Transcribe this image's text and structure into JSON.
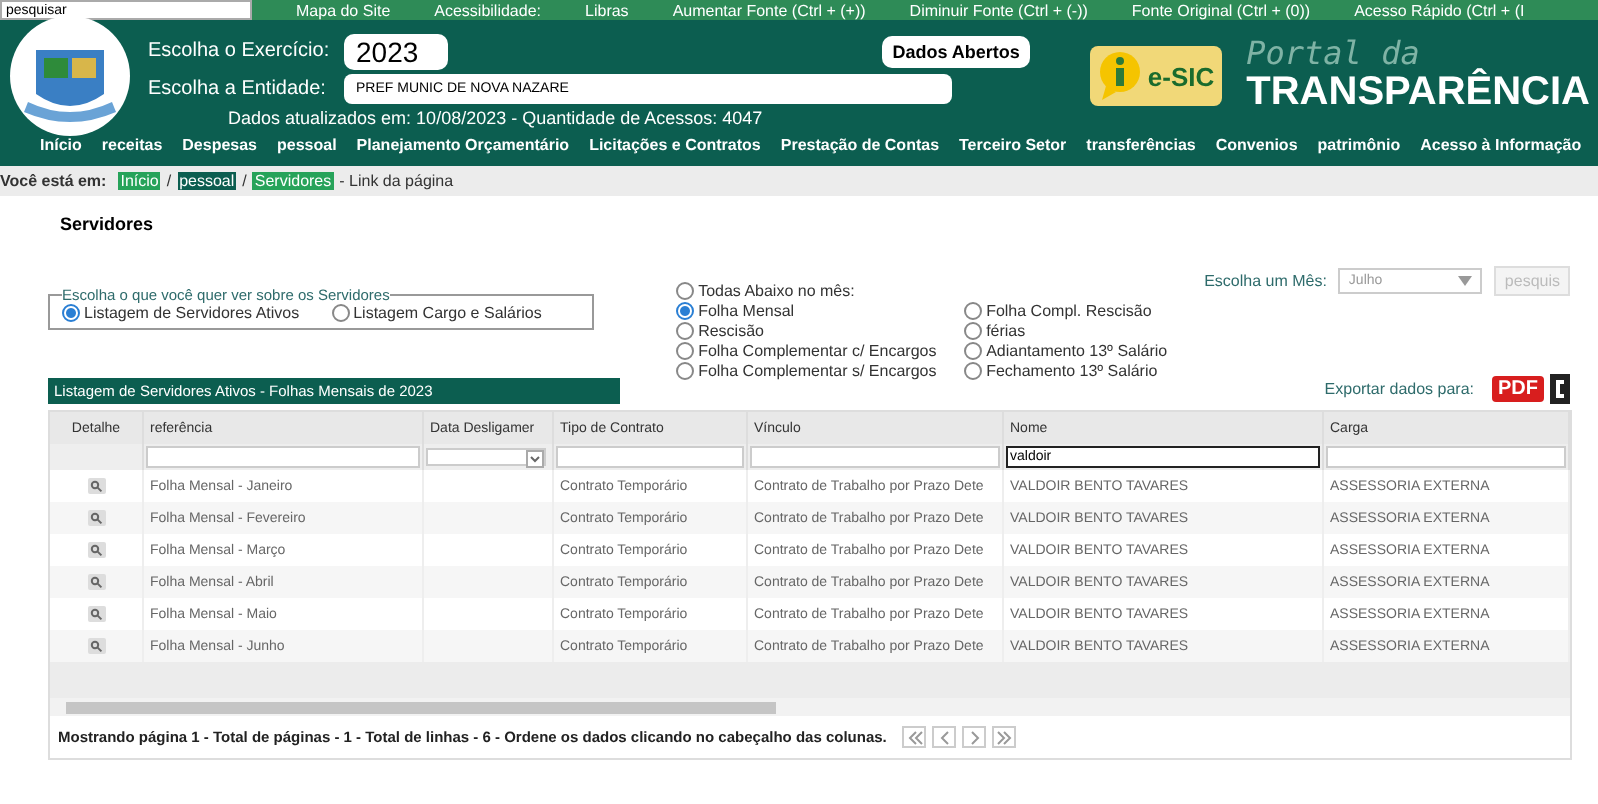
{
  "top_bar": {
    "search": {
      "value": "pesquisar"
    },
    "links": [
      "Mapa do Site",
      "Acessibilidade:",
      "Libras",
      "Aumentar Fonte (Ctrl + (+))",
      "Diminuir Fonte (Ctrl + (-))",
      "Fonte Original (Ctrl + (0))",
      "Acesso Rápido (Ctrl + (I"
    ]
  },
  "header": {
    "exercise_label": "Escolha o Exercício:",
    "exercise_value": "2023",
    "entity_label": "Escolha a Entidade:",
    "entity_value": "PREF MUNIC DE NOVA NAZARE",
    "open_data_button": "Dados Abertos",
    "updated_text": "Dados atualizados em: 10/08/2023 - Quantidade de Acessos: 4047",
    "esic_logo": "e-SIC",
    "portal_line1": "Portal da",
    "portal_line2": "TRANSPARÊNCIA"
  },
  "nav": [
    "Início",
    "receitas",
    "Despesas",
    "pessoal",
    "Planejamento Orçamentário",
    "Licitações e Contratos",
    "Prestação de Contas",
    "Terceiro Setor",
    "transferências",
    "Convenios",
    "patrimônio",
    "Acesso à Informação"
  ],
  "breadcrumb": {
    "label": "Você está em:",
    "items": [
      "Início",
      "pessoal",
      "Servidores"
    ],
    "separators": [
      "/",
      "/"
    ],
    "suffix": "- Link da página"
  },
  "page_title": "Servidores",
  "view_choice": {
    "legend": "Escolha o que você quer ver sobre os Servidores",
    "options": [
      {
        "label": "Listagem de Servidores Ativos",
        "selected": true
      },
      {
        "label": "Listagem Cargo e Salários",
        "selected": false
      }
    ]
  },
  "payroll_types": [
    {
      "label": "Todas Abaixo no mês:",
      "selected": false
    },
    {
      "label": "Folha Mensal",
      "selected": true
    },
    {
      "label": "Folha Compl. Rescisão",
      "selected": false
    },
    {
      "label": "Rescisão",
      "selected": false
    },
    {
      "label": "férias",
      "selected": false
    },
    {
      "label": "Folha Complementar c/ Encargos",
      "selected": false
    },
    {
      "label": "Adiantamento 13º Salário",
      "selected": false
    },
    {
      "label": "Folha Complementar s/ Encargos",
      "selected": false
    },
    {
      "label": "Fechamento 13º Salário",
      "selected": false
    }
  ],
  "month_filter": {
    "label": "Escolha um Mês:",
    "value": "Julho",
    "button": "pesquis",
    "disabled": true
  },
  "export": {
    "label": "Exportar dados para:",
    "pdf_button": "PDF"
  },
  "table": {
    "title": "Listagem de Servidores Ativos - Folhas Mensais de 2023",
    "columns": [
      "Detalhe",
      "referência",
      "Data Desligamer",
      "Tipo de Contrato",
      "Vínculo",
      "Nome",
      "Carga"
    ],
    "filters": [
      {
        "kind": "none"
      },
      {
        "kind": "text"
      },
      {
        "kind": "select"
      },
      {
        "kind": "text"
      },
      {
        "kind": "text"
      },
      {
        "kind": "text",
        "value": "valdoir",
        "focused": true
      },
      {
        "kind": "text"
      }
    ],
    "rows": [
      [
        "",
        "Folha Mensal - Janeiro",
        "",
        "Contrato Temporário",
        "Contrato de Trabalho por Prazo Dete",
        "VALDOIR BENTO TAVARES",
        "ASSESSORIA EXTERNA"
      ],
      [
        "",
        "Folha Mensal - Fevereiro",
        "",
        "Contrato Temporário",
        "Contrato de Trabalho por Prazo Dete",
        "VALDOIR BENTO TAVARES",
        "ASSESSORIA EXTERNA"
      ],
      [
        "",
        "Folha Mensal - Março",
        "",
        "Contrato Temporário",
        "Contrato de Trabalho por Prazo Dete",
        "VALDOIR BENTO TAVARES",
        "ASSESSORIA EXTERNA"
      ],
      [
        "",
        "Folha Mensal - Abril",
        "",
        "Contrato Temporário",
        "Contrato de Trabalho por Prazo Dete",
        "VALDOIR BENTO TAVARES",
        "ASSESSORIA EXTERNA"
      ],
      [
        "",
        "Folha Mensal - Maio",
        "",
        "Contrato Temporário",
        "Contrato de Trabalho por Prazo Dete",
        "VALDOIR BENTO TAVARES",
        "ASSESSORIA EXTERNA"
      ],
      [
        "",
        "Folha Mensal - Junho",
        "",
        "Contrato Temporário",
        "Contrato de Trabalho por Prazo Dete",
        "VALDOIR BENTO TAVARES",
        "ASSESSORIA EXTERNA"
      ]
    ],
    "footer": "Mostrando página 1 - Total de páginas - 1 - Total de linhas - 6 - Ordene os dados clicando no cabeçalho das colunas."
  }
}
